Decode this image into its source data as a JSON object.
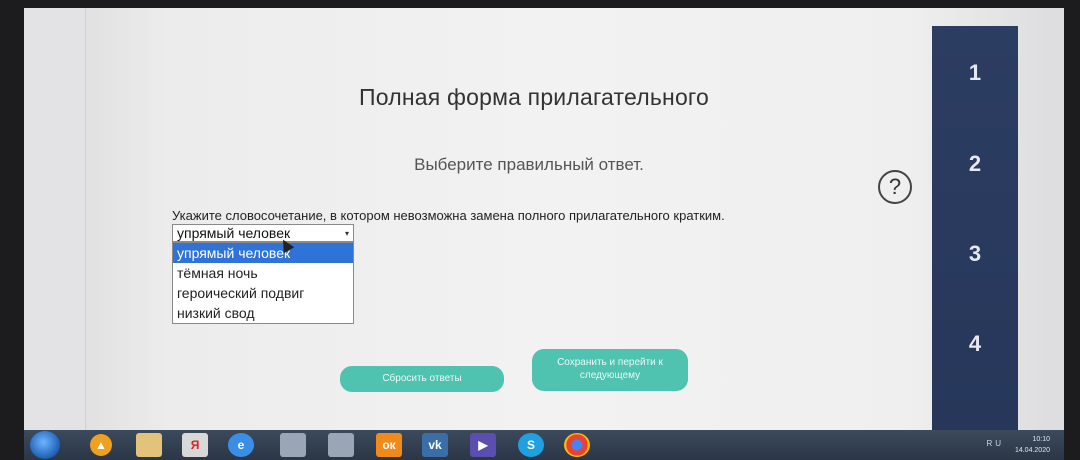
{
  "page": {
    "title": "Полная форма прилагательного",
    "subtitle": "Выберите правильный ответ.",
    "help_symbol": "?"
  },
  "question": {
    "text": "Укажите словосочетание, в котором невозможна замена полного прилагательного кратким.",
    "select": {
      "current_value": "упрямый человек",
      "arrow": "▾",
      "options": [
        "упрямый человек",
        "тёмная ночь",
        "героический подвиг",
        "низкий свод"
      ],
      "highlighted_option": "упрямый человек"
    }
  },
  "buttons": {
    "reset_label": "Сбросить ответы",
    "next_line1": "Сохранить и перейти к",
    "next_line2": "следующему"
  },
  "side_nav": {
    "items": [
      "1",
      "2",
      "3",
      "4"
    ]
  },
  "taskbar": {
    "icons": [
      "windows-start-icon",
      "avast-icon",
      "file-explorer-icon",
      "yandex-browser-icon",
      "internet-explorer-icon",
      "document-icon",
      "document-icon",
      "odnoklassniki-icon",
      "vk-icon",
      "media-player-icon",
      "skype-icon",
      "chrome-icon"
    ],
    "tray": {
      "language": "RU",
      "time": "10:10",
      "date": "14.04.2020"
    }
  },
  "colors": {
    "accent_button": "#4fc2b0",
    "side_nav": "#2c3d62",
    "selected_option": "#2f73d8"
  }
}
